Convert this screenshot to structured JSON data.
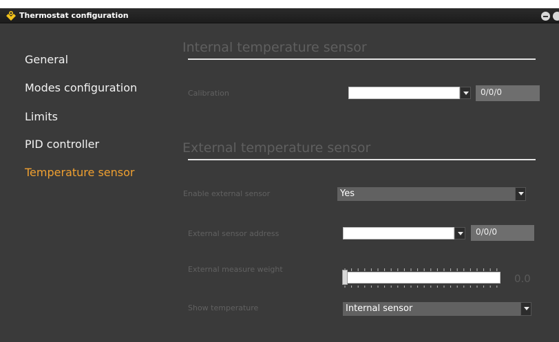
{
  "window": {
    "title": "Thermostat configuration",
    "icon": "thermostat-app-icon",
    "controls": [
      "minimize-icon",
      "close-icon"
    ]
  },
  "sidebar": {
    "items": [
      {
        "label": "General",
        "active": false
      },
      {
        "label": "Modes configuration",
        "active": false
      },
      {
        "label": "Limits",
        "active": false
      },
      {
        "label": "PID controller",
        "active": false
      },
      {
        "label": "Temperature sensor",
        "active": true
      }
    ]
  },
  "internal_section": {
    "title": "Internal temperature sensor",
    "calibration": {
      "label": "Calibration",
      "value": "",
      "address": "0/0/0"
    }
  },
  "external_section": {
    "title": "External temperature sensor",
    "enable": {
      "label": "Enable external sensor",
      "value": "Yes"
    },
    "address": {
      "label": "External sensor address",
      "value": "",
      "address": "0/0/0"
    },
    "weight": {
      "label": "External measure weight",
      "value": "0.0",
      "fraction": 0.0
    },
    "show": {
      "label": "Show temperature",
      "value": "Internal sensor"
    }
  },
  "colors": {
    "background": "#3a3a3a",
    "active_nav": "#f0a030",
    "section_title": "#5f5f5f",
    "label": "#616161"
  }
}
